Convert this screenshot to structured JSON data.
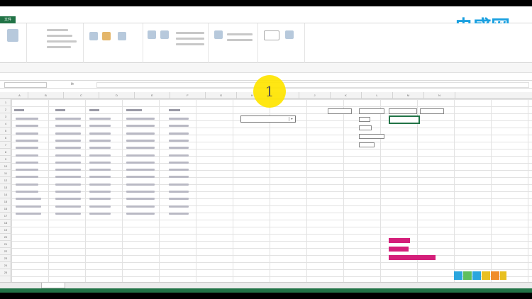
{
  "window": {
    "title": ""
  },
  "ribbon": {
    "file_tab": "文件",
    "tabs": [
      "",
      "",
      "",
      "",
      "",
      "",
      "",
      ""
    ]
  },
  "watermark": {
    "logo_cn": "央盛网",
    "logo_en": ""
  },
  "formula_bar": {
    "fx": "fx",
    "cell_ref": "",
    "content": ""
  },
  "overlay": {
    "step_number": "1",
    "step_color": "#ffe500"
  },
  "columns": [
    "A",
    "B",
    "C",
    "D",
    "E",
    "F",
    "G",
    "H",
    "I",
    "J",
    "K",
    "L",
    "M",
    "N"
  ],
  "rows": [
    "1",
    "2",
    "3",
    "4",
    "5",
    "6",
    "7",
    "8",
    "9",
    "10",
    "11",
    "12",
    "13",
    "14",
    "15",
    "16",
    "17",
    "18",
    "19",
    "20",
    "21",
    "22",
    "23",
    "24",
    "25"
  ],
  "sheet": {
    "tab_name": ""
  },
  "legend": {
    "accent_color": "#d41f7a"
  },
  "colors": {
    "excel_green": "#217346",
    "logo_blue": "#1aa0e0"
  }
}
